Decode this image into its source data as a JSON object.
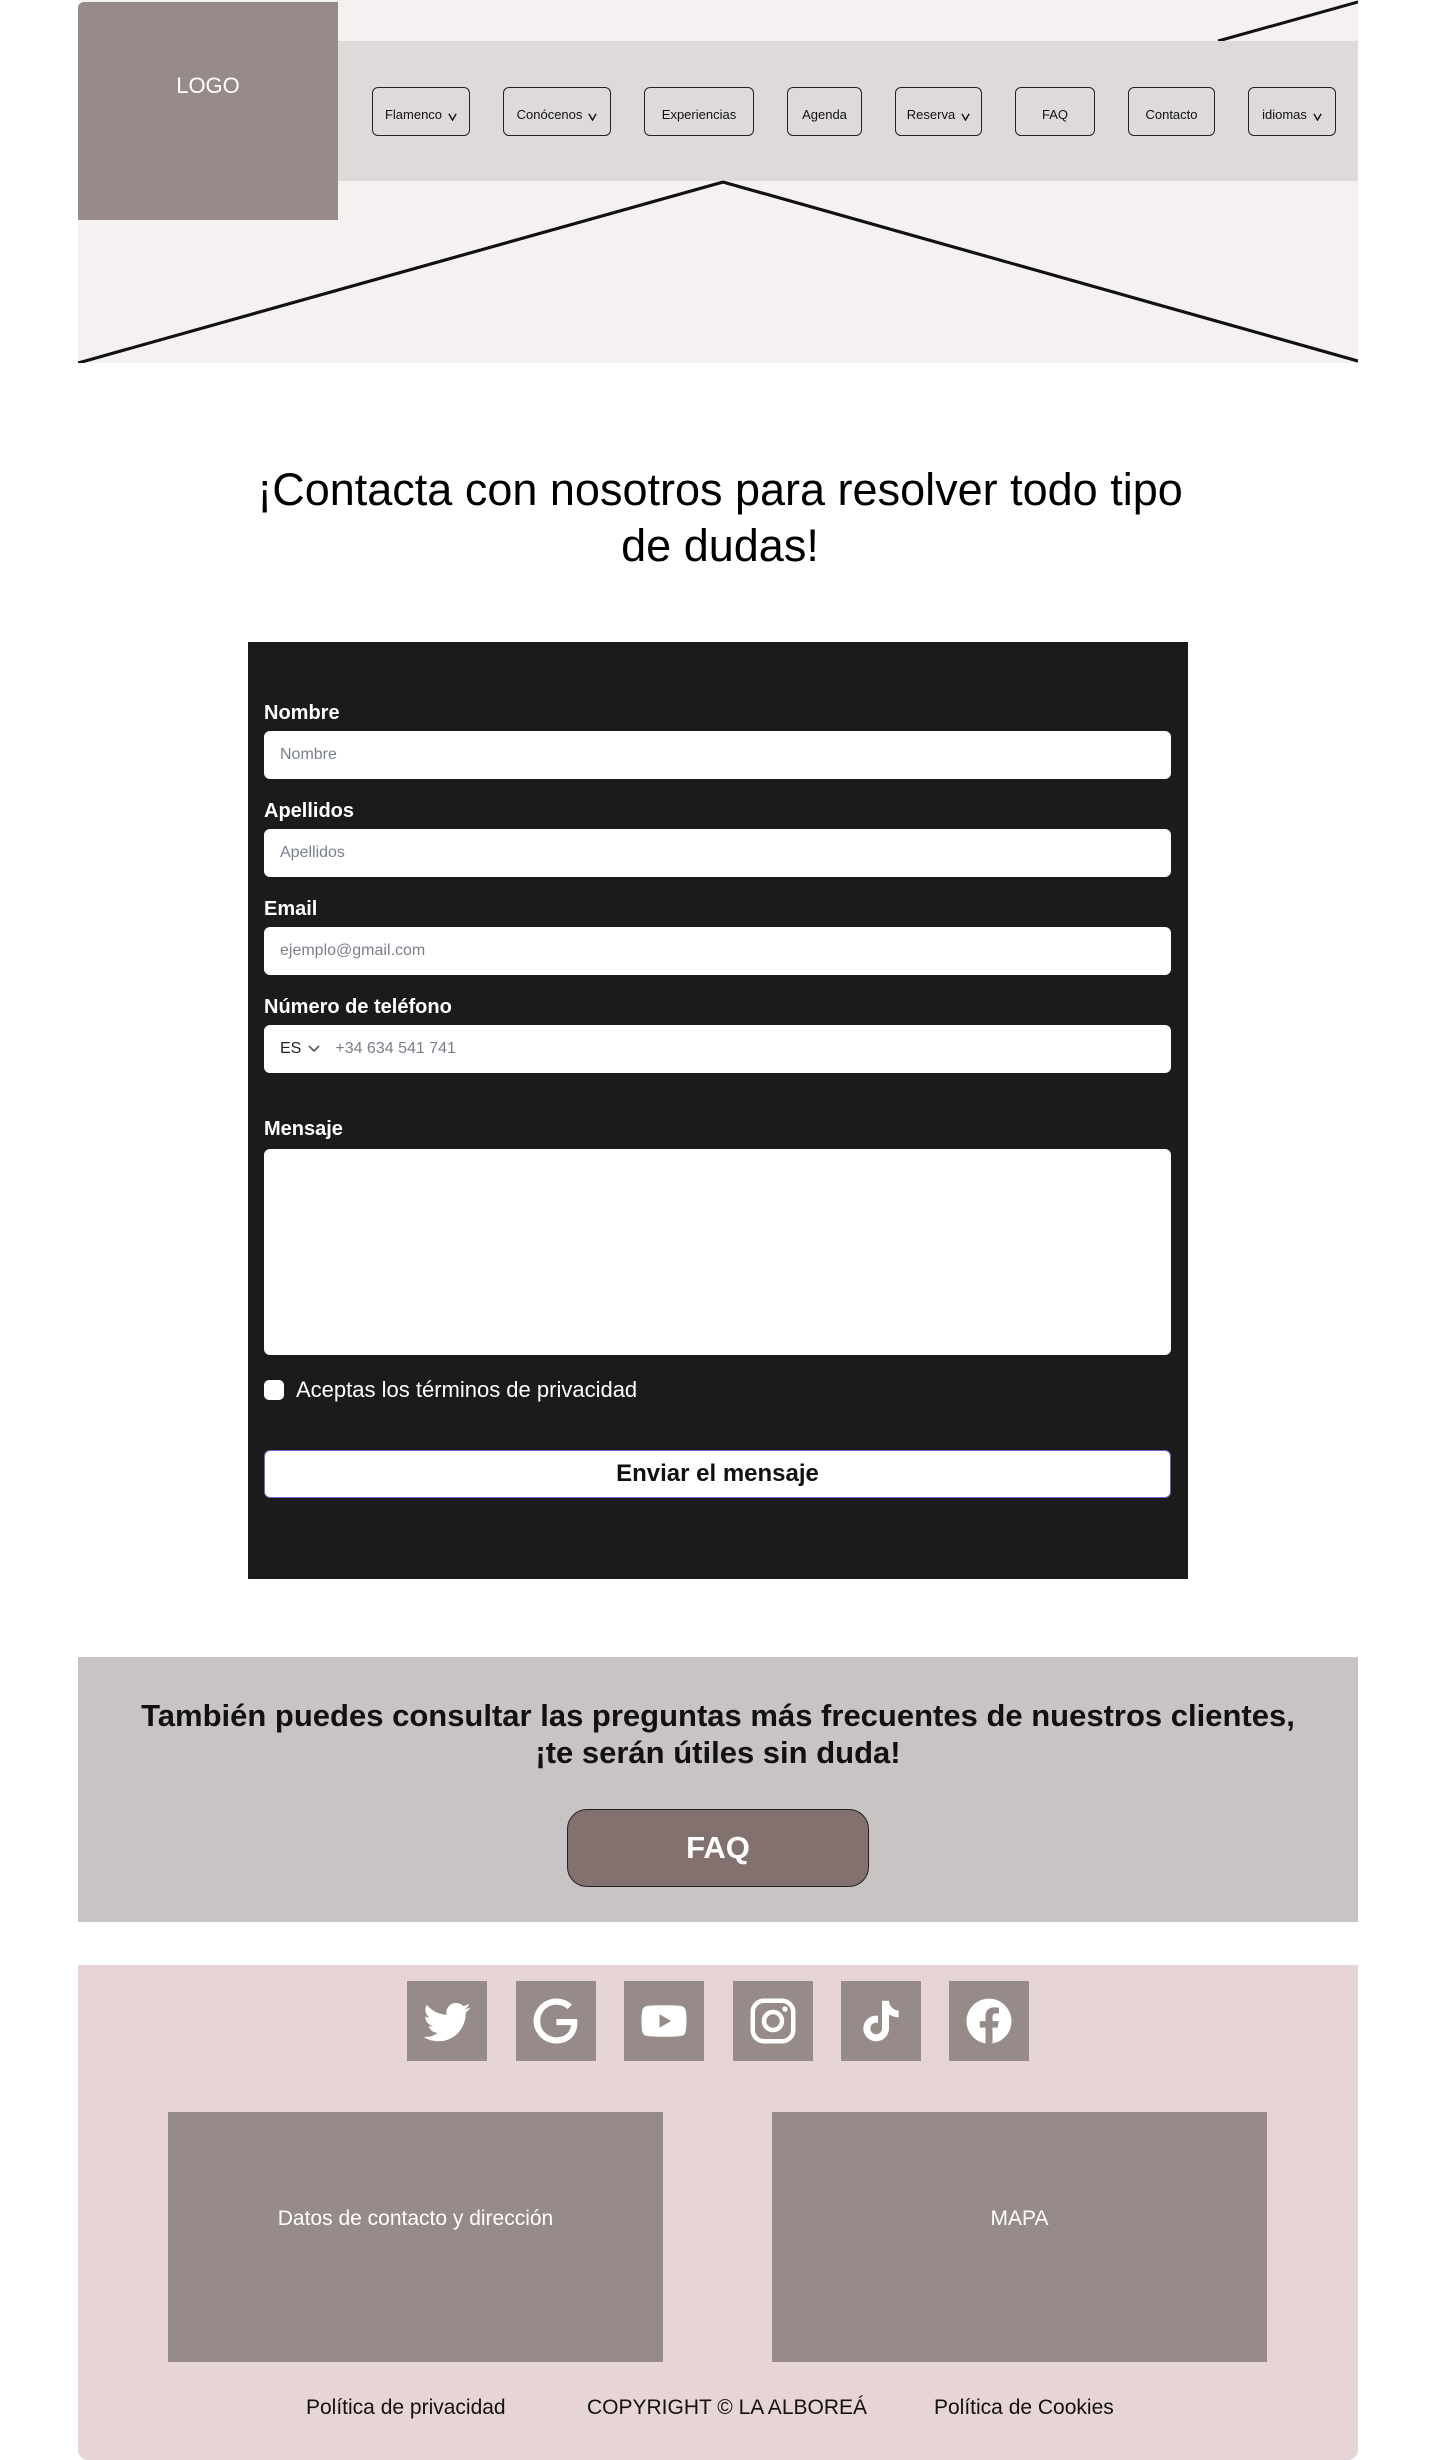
{
  "header": {
    "logo_text": "LOGO",
    "nav": [
      {
        "label": "Flamenco",
        "has_dropdown": true
      },
      {
        "label": "Conócenos",
        "has_dropdown": true
      },
      {
        "label": "Experiencias",
        "has_dropdown": false
      },
      {
        "label": "Agenda",
        "has_dropdown": false
      },
      {
        "label": "Reserva",
        "has_dropdown": true
      },
      {
        "label": "FAQ",
        "has_dropdown": false
      },
      {
        "label": "Contacto",
        "has_dropdown": false
      },
      {
        "label": "idiomas",
        "has_dropdown": true
      }
    ]
  },
  "main": {
    "title": "¡Contacta con nosotros para resolver todo tipo de dudas!"
  },
  "form": {
    "fields": {
      "nombre": {
        "label": "Nombre",
        "placeholder": "Nombre"
      },
      "apellidos": {
        "label": "Apellidos",
        "placeholder": "Apellidos"
      },
      "email": {
        "label": "Email",
        "placeholder": "ejemplo@gmail.com"
      },
      "telefono": {
        "label": "Número de teléfono",
        "country_code": "ES",
        "placeholder": "+34 634 541 741"
      },
      "mensaje": {
        "label": "Mensaje"
      }
    },
    "privacy_label": "Aceptas los términos de privacidad",
    "submit_label": "Enviar el mensaje"
  },
  "faq": {
    "text": "También puedes consultar las preguntas más frecuentes de nuestros clientes, ¡te serán útiles sin duda!",
    "button_label": "FAQ"
  },
  "footer": {
    "social_icons": [
      "twitter-icon",
      "google-icon",
      "youtube-icon",
      "instagram-icon",
      "tiktok-icon",
      "facebook-icon"
    ],
    "contact_box": "Datos de contacto y dirección",
    "map_box": "MAPA",
    "links": {
      "privacy": "Política de privacidad",
      "copyright": "COPYRIGHT © LA ALBOREÁ",
      "cookies": "Política de Cookies"
    }
  },
  "colors": {
    "logo_bg": "#978b8a",
    "navbar_bg": "#dedada",
    "hero_bg": "#f4f1f0",
    "form_bg": "#1b1b1b",
    "faq_band_bg": "#c9c4c3",
    "faq_button_bg": "#837170",
    "footer_bg": "#e7d4d6"
  }
}
